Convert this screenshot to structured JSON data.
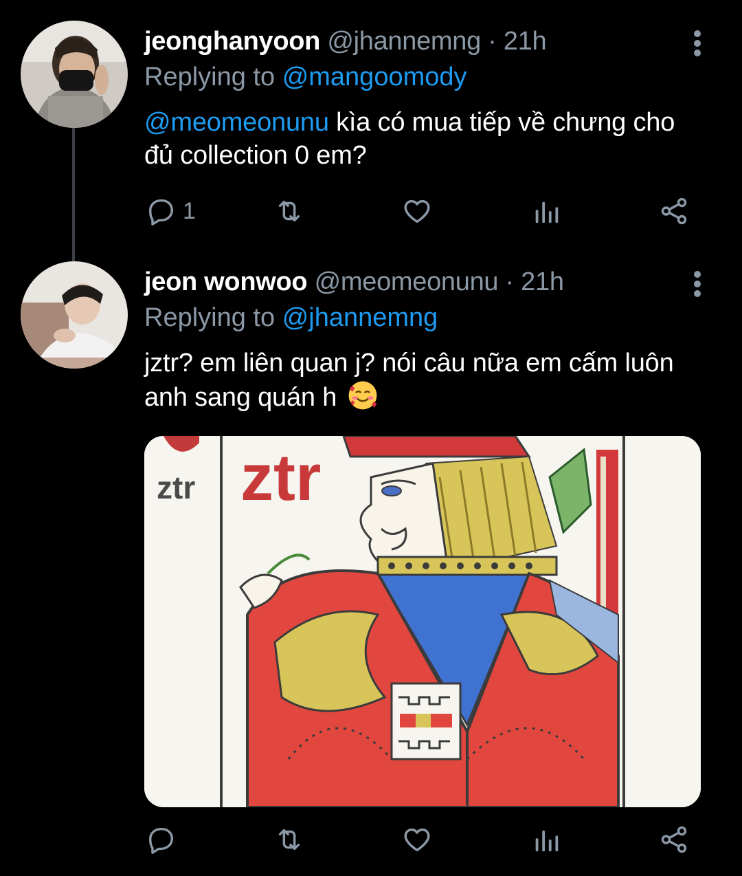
{
  "colors": {
    "background": "#000000",
    "text_primary": "#ffffff",
    "text_secondary": "#8b98a5",
    "link": "#1d9bf0"
  },
  "tweets": [
    {
      "display_name": "jeonghanyoon",
      "handle": "@jhannemng",
      "separator": "·",
      "time": "21h",
      "replying_prefix": "Replying to",
      "replying_to": "@mangoomody",
      "mention": "@meomeonunu",
      "text": " kìa có mua tiếp về chưng cho đủ collection 0 em?",
      "actions": {
        "reply_icon": "reply-icon",
        "reply_count": "1",
        "retweet_icon": "retweet-icon",
        "like_icon": "heart-icon",
        "analytics_icon": "analytics-icon",
        "share_icon": "share-icon"
      }
    },
    {
      "display_name": "jeon wonwoo",
      "handle": "@meomeonunu",
      "separator": "·",
      "time": "21h",
      "replying_prefix": "Replying to",
      "replying_to": "@jhannemng",
      "text": "jztr? em liên quan j? nói câu nữa em cấm luôn anh sang quán h",
      "emoji": "smiling-face-with-hearts-emoji",
      "media": {
        "type": "image",
        "description_icon": "playing-card-jack-image",
        "card_text_small": "ztr",
        "card_text_large": "ztr"
      },
      "actions": {
        "reply_icon": "reply-icon",
        "retweet_icon": "retweet-icon",
        "like_icon": "heart-icon",
        "analytics_icon": "analytics-icon",
        "share_icon": "share-icon"
      }
    }
  ]
}
